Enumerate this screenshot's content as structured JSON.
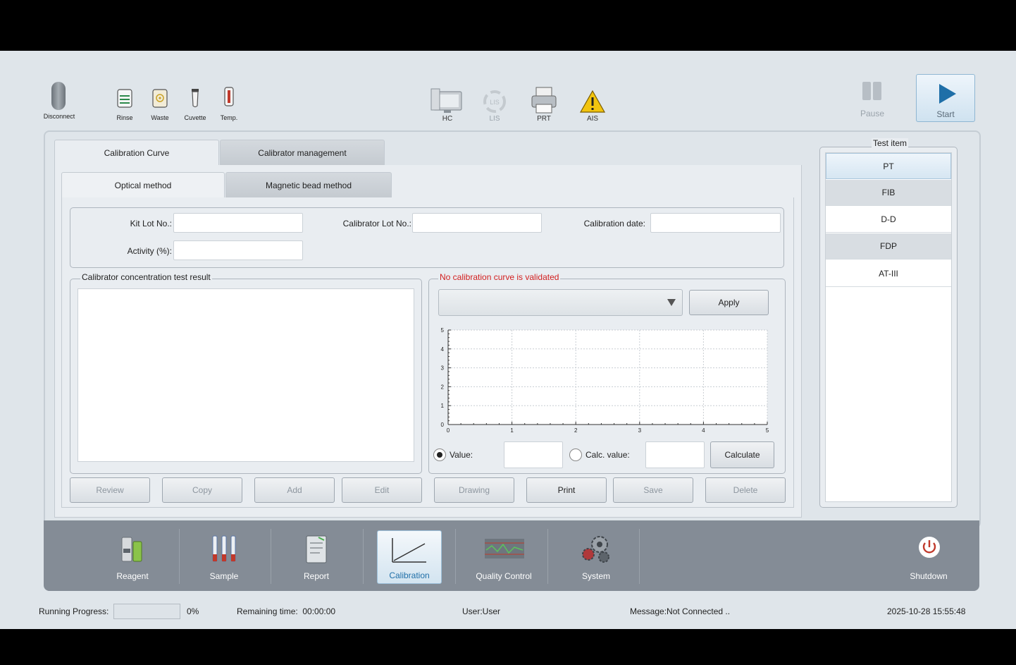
{
  "toolbar": {
    "disconnect": "Disconnect",
    "rinse": "Rinse",
    "waste": "Waste",
    "cuvette": "Cuvette",
    "temp": "Temp.",
    "hc": "HC",
    "lis": "LIS",
    "lis_icon_text": "LIS",
    "prt": "PRT",
    "ais": "AIS",
    "pause": "Pause",
    "start": "Start"
  },
  "tabs": {
    "calibration_curve": "Calibration Curve",
    "calibrator_management": "Calibrator management",
    "optical_method": "Optical method",
    "magnetic_bead_method": "Magnetic bead method"
  },
  "form": {
    "kit_lot_label": "Kit Lot No.:",
    "kit_lot_value": "",
    "calibrator_lot_label": "Calibrator Lot No.:",
    "calibrator_lot_value": "",
    "calibration_date_label": "Calibration date:",
    "calibration_date_value": "",
    "activity_label": "Activity (%):",
    "activity_value": ""
  },
  "result_panel": {
    "title": "Calibrator concentration test result"
  },
  "curve_panel": {
    "title": "No calibration curve is validated",
    "title_color": "#d21f1f",
    "dropdown_value": "",
    "apply": "Apply",
    "value_label": "Value:",
    "value_value": "",
    "calc_value_label": "Calc. value:",
    "calc_value_value": "",
    "calculate": "Calculate",
    "value_radio_checked": true
  },
  "chart_data": {
    "type": "line",
    "title": "",
    "xlabel": "",
    "ylabel": "",
    "xlim": [
      0,
      5
    ],
    "ylim": [
      0,
      5
    ],
    "x_ticks": [
      "0",
      "1",
      "2",
      "3",
      "4",
      "5"
    ],
    "y_ticks": [
      "0",
      "1",
      "2",
      "3",
      "4",
      "5"
    ],
    "grid": true,
    "series": []
  },
  "actions": {
    "review": "Review",
    "copy": "Copy",
    "add": "Add",
    "edit": "Edit",
    "drawing": "Drawing",
    "print": "Print",
    "save": "Save",
    "delete": "Delete"
  },
  "test_item": {
    "title": "Test item",
    "items": [
      "PT",
      "FIB",
      "D-D",
      "FDP",
      "AT-III"
    ]
  },
  "nav": {
    "reagent": "Reagent",
    "sample": "Sample",
    "report": "Report",
    "calibration": "Calibration",
    "quality_control": "Quality Control",
    "system": "System",
    "shutdown": "Shutdown"
  },
  "status": {
    "running_progress_label": "Running Progress:",
    "progress_percent": "0%",
    "progress_fraction": 0,
    "remaining_time": "Remaining time:  00:00:00",
    "user": "User:User",
    "message": "Message:Not Connected ..",
    "datetime": "2025-10-28 15:55:48"
  },
  "colors": {
    "accent": "#1f6fa8",
    "nav_bar": "#848c96",
    "background": "#dfe5ea"
  }
}
